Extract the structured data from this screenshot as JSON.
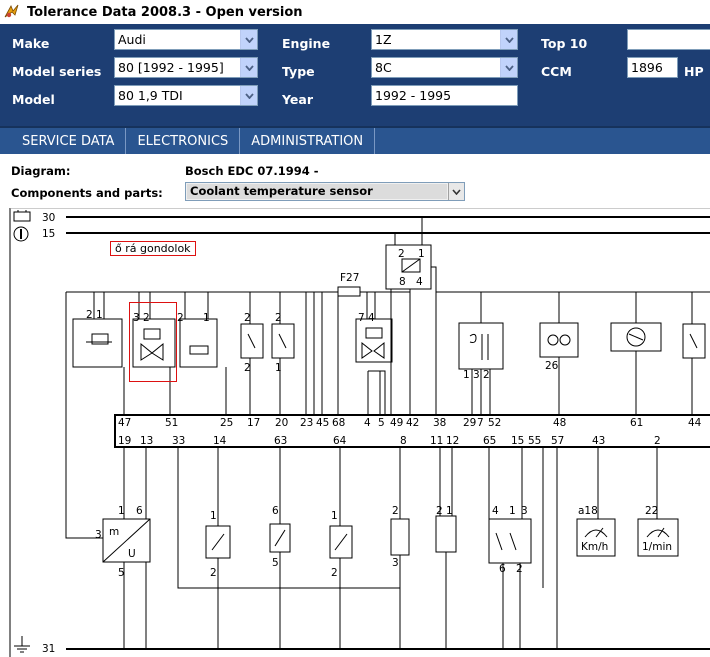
{
  "window": {
    "title": "Tolerance Data 2008.3 - Open version",
    "icon": "app-logo-icon"
  },
  "header": {
    "make": {
      "label": "Make",
      "value": "Audi"
    },
    "model_series": {
      "label": "Model series",
      "value": "80 [1992 - 1995]"
    },
    "model": {
      "label": "Model",
      "value": "80 1,9 TDI"
    },
    "engine": {
      "label": "Engine",
      "value": "1Z"
    },
    "type": {
      "label": "Type",
      "value": "8C"
    },
    "year": {
      "label": "Year",
      "value": "1992 - 1995"
    },
    "top10": {
      "label": "Top 10",
      "value": ""
    },
    "ccm": {
      "label": "CCM",
      "value": "1896",
      "unit": "HP"
    },
    "colors": {
      "header_bg": "#1d3e73",
      "nav_bg": "#2a5590"
    }
  },
  "nav": {
    "tabs": [
      "SERVICE DATA",
      "ELECTRONICS",
      "ADMINISTRATION"
    ]
  },
  "info": {
    "diagram_label": "Diagram:",
    "diagram_value": "Bosch EDC 07.1994 -",
    "components_label": "Components and parts:",
    "components_value": "Coolant temperature sensor"
  },
  "diagram": {
    "rail_labels": [
      "30",
      "15",
      "31"
    ],
    "fuse": "F27",
    "relay_pins": [
      "2",
      "1",
      "8",
      "4"
    ],
    "annotation": "ő rá gondolok",
    "ecu_top_pins": [
      "47",
      "51",
      "25",
      "17",
      "20",
      "23",
      "45",
      "68",
      "4",
      "5",
      "49",
      "42",
      "38",
      "29",
      "7",
      "52",
      "48",
      "61",
      "44"
    ],
    "ecu_bottom_pins": [
      "19",
      "13",
      "33",
      "14",
      "63",
      "64",
      "8",
      "11",
      "12",
      "65",
      "15",
      "55",
      "57",
      "43",
      "2"
    ],
    "top_component_pins": [
      "2 1",
      "3 2",
      "2",
      "1",
      "2",
      "2",
      "7 4",
      "2",
      "1",
      "1",
      "1 3 2",
      "26"
    ],
    "bottom_component_pins": [
      "1",
      "6",
      "3",
      "5",
      "2",
      "1",
      "2",
      "6",
      "5",
      "1",
      "2",
      "2",
      "1",
      "3",
      "2 1",
      "4",
      "1",
      "3",
      "6",
      "2",
      "a18",
      "22"
    ],
    "motor_labels": {
      "m": "m",
      "u": "U"
    },
    "gauge_labels": [
      "Km/h",
      "1/min"
    ]
  }
}
